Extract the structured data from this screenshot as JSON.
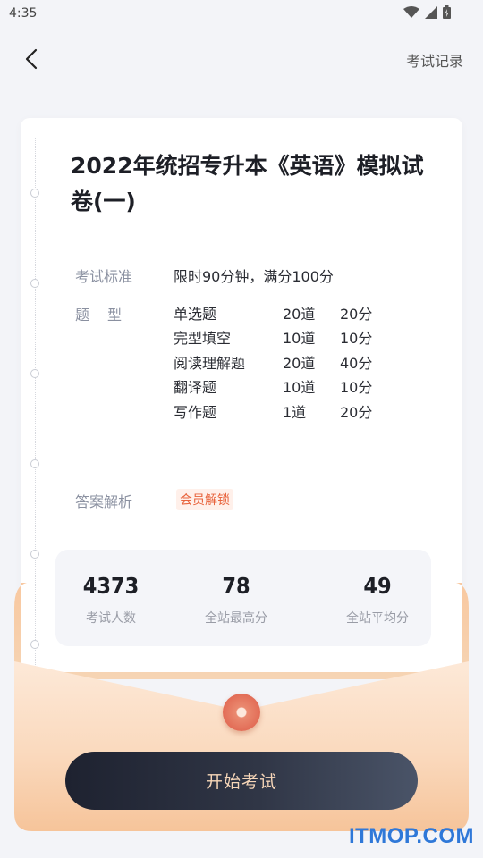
{
  "status_bar": {
    "time": "4:35"
  },
  "header": {
    "history_label": "考试记录"
  },
  "exam": {
    "title": "2022年统招专升本《英语》模拟试卷(一)",
    "standard_label": "考试标准",
    "standard_value": "限时90分钟，满分100分",
    "type_label": "题　型",
    "subjects": [
      {
        "name": "单选题",
        "count": "20道",
        "score": "20分"
      },
      {
        "name": "完型填空",
        "count": "10道",
        "score": "10分"
      },
      {
        "name": "阅读理解题",
        "count": "20道",
        "score": "40分"
      },
      {
        "name": "翻译题",
        "count": "10道",
        "score": "10分"
      },
      {
        "name": "写作题",
        "count": "1道",
        "score": "20分"
      }
    ],
    "analysis_label": "答案解析",
    "analysis_badge": "会员解锁"
  },
  "stats": [
    {
      "value": "4373",
      "label": "考试人数"
    },
    {
      "value": "78",
      "label": "全站最高分"
    },
    {
      "value": "49",
      "label": "全站平均分"
    }
  ],
  "start_button": "开始考试",
  "watermark": "ITMOP.COM",
  "colors": {
    "accent": "#e8643d",
    "button_dark": "#1e2230",
    "envelope": "#f7c9a0"
  }
}
